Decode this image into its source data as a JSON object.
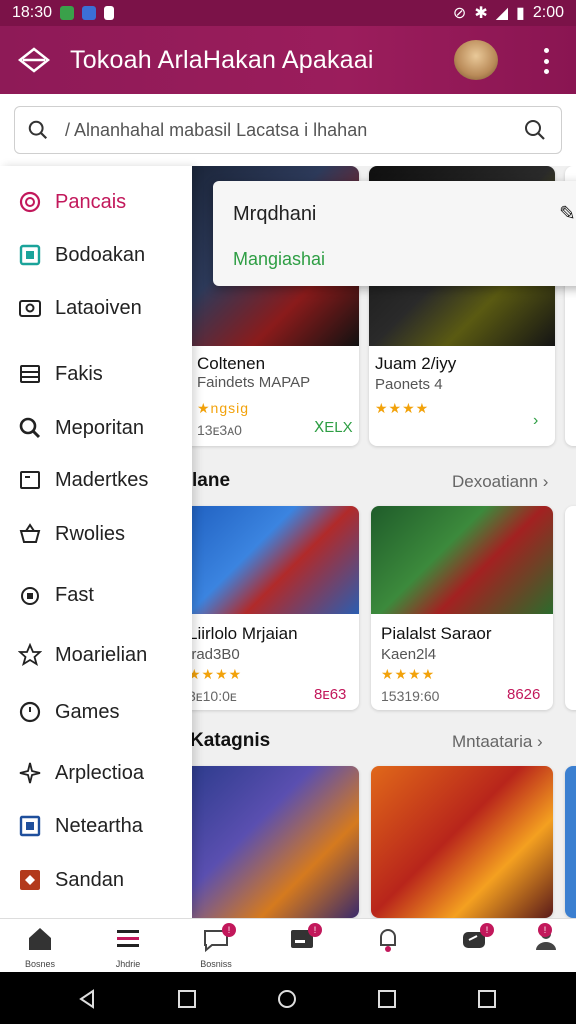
{
  "status_bar": {
    "time": "18:30",
    "right_time": "2:00"
  },
  "app_bar": {
    "title": "Tokoah ArlaHakan Apakaai"
  },
  "search": {
    "placeholder": "/ Alnanhahal mabasil Lacatsa i lhahan"
  },
  "drawer": {
    "items": [
      {
        "label": "Pancais",
        "icon": "target-icon",
        "color": "#c2185b"
      },
      {
        "label": "Bodoakan",
        "icon": "tablet-icon",
        "color": "#1aa39a"
      },
      {
        "label": "Lataoiven",
        "icon": "camera-icon",
        "color": "#222"
      },
      {
        "label": "Fakis",
        "icon": "list-icon",
        "color": "#222"
      },
      {
        "label": "Meporitan",
        "icon": "search-icon",
        "color": "#222"
      },
      {
        "label": "Madertkes",
        "icon": "window-icon",
        "color": "#222"
      },
      {
        "label": "Rwolies",
        "icon": "basket-icon",
        "color": "#222"
      },
      {
        "label": "Fast",
        "icon": "lock-icon",
        "color": "#222"
      },
      {
        "label": "Moarielian",
        "icon": "star-icon",
        "color": "#222"
      },
      {
        "label": "Games",
        "icon": "clock-icon",
        "color": "#222"
      },
      {
        "label": "Arplectioa",
        "icon": "sparkle-icon",
        "color": "#222"
      },
      {
        "label": "Neteartha",
        "icon": "calendar-icon",
        "color": "#1f4f9c"
      },
      {
        "label": "Sandan",
        "icon": "gift-icon",
        "color": "#b33a1c"
      }
    ]
  },
  "popup": {
    "title": "Mrqdhani",
    "subtitle": "Mangiashai"
  },
  "top_cards": [
    {
      "name": "Coltenen",
      "sub": "Faindets MAPAP",
      "stars": "★ngsig",
      "meta": "13ᴇ3ᴀ0",
      "price": "ꓫELX"
    },
    {
      "name": "Juam 2/iyy",
      "sub": "Paonets 4",
      "stars": "★★★★",
      "meta": "",
      "price": ""
    }
  ],
  "sections": [
    {
      "title": "lane",
      "see_more": "Dexoatiann"
    },
    {
      "title": "Katagnis",
      "see_more": "Mntaataria"
    }
  ],
  "mid_cards": [
    {
      "name": "Liirlolo Mrjaian",
      "sub": "lrad3B0",
      "stars": "★★★★",
      "meta": "3ᴇ10:0ᴇ",
      "price": "8ᴇ63"
    },
    {
      "name": "Pialalst Saraor",
      "sub": "Kaen2l4",
      "stars": "★★★★",
      "meta": "15319:60",
      "price": "8626"
    }
  ],
  "bottom_nav": [
    {
      "label": "Bosnes",
      "icon": "home-icon"
    },
    {
      "label": "Jhdrie",
      "icon": "menu-icon"
    },
    {
      "label": "Bosniss",
      "icon": "chat-icon"
    },
    {
      "label": "",
      "icon": "card-icon"
    },
    {
      "label": "",
      "icon": "bell-icon"
    },
    {
      "label": "",
      "icon": "gamepad-icon"
    },
    {
      "label": "",
      "icon": "profile-icon"
    }
  ]
}
